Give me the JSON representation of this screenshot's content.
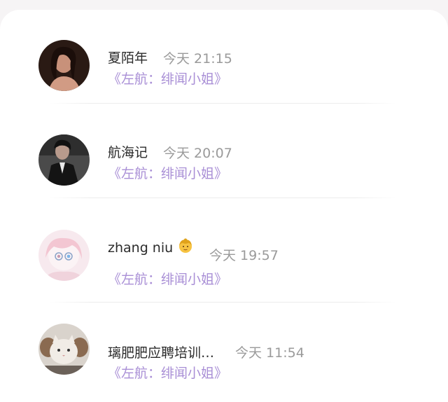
{
  "comments": [
    {
      "user": "夏陌年",
      "time": "今天 21:15",
      "book": "《左航：绯闻小姐》"
    },
    {
      "user": "航海记",
      "time": "今天 20:07",
      "book": "《左航：绯闻小姐》"
    },
    {
      "user": "zhang niu",
      "user_emoji": "girl-emoji-icon",
      "time": "今天 19:57",
      "book": "《左航：绯闻小姐》"
    },
    {
      "user": "璃肥肥应聘培训…",
      "time": "今天 11:54",
      "book": "《左航：绯闻小姐》"
    }
  ]
}
